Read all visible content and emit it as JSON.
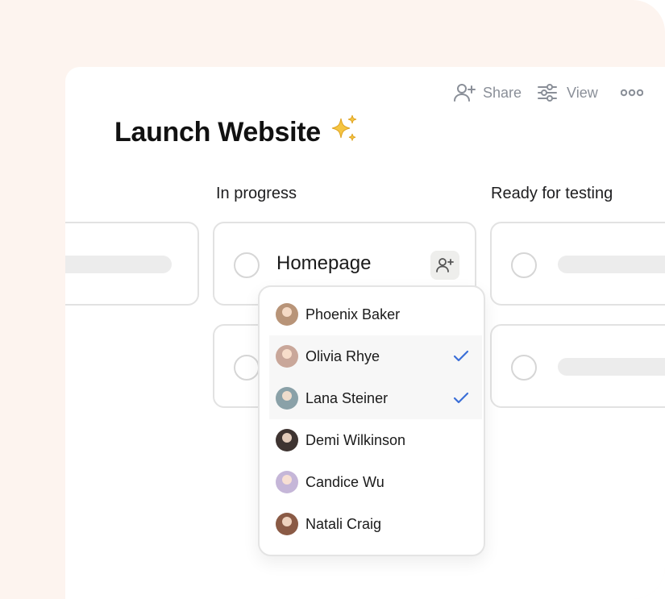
{
  "header": {
    "title": "Launch Website",
    "title_emoji": "✨",
    "share_label": "Share",
    "view_label": "View"
  },
  "columns": [
    {
      "title": ""
    },
    {
      "title": "In progress"
    },
    {
      "title": "Ready for testing"
    }
  ],
  "cards": {
    "homepage_title": "Homepage"
  },
  "assignee_menu": {
    "people": [
      {
        "name": "Phoenix Baker",
        "selected": false,
        "avatar_color": "#b89478"
      },
      {
        "name": "Olivia Rhye",
        "selected": true,
        "avatar_color": "#c9a79a"
      },
      {
        "name": "Lana Steiner",
        "selected": true,
        "avatar_color": "#8aa1a8"
      },
      {
        "name": "Demi Wilkinson",
        "selected": false,
        "avatar_color": "#3e3431"
      },
      {
        "name": "Candice Wu",
        "selected": false,
        "avatar_color": "#c5b6d8"
      },
      {
        "name": "Natali Craig",
        "selected": false,
        "avatar_color": "#8a5a45"
      }
    ]
  },
  "colors": {
    "accent_check": "#3b6fd8",
    "background_peach": "#fdf4ef",
    "icon_grey": "#8a8f98"
  }
}
